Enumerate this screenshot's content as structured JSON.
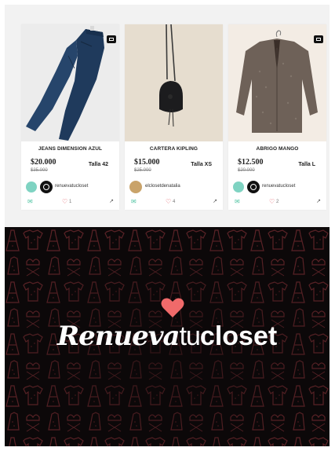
{
  "products": [
    {
      "title": "JEANS DIMENSION AZUL",
      "price": "$20.000",
      "old_price": "$35.000",
      "size": "Talla 42",
      "seller": "renuevatucloset",
      "likes": "1",
      "photo_icon": "jeans"
    },
    {
      "title": "CARTERA KIPLING",
      "price": "$15.000",
      "old_price": "$25.000",
      "size": "Talla XS",
      "seller": "elclosetdenatalia",
      "likes": "4",
      "photo_icon": "bag"
    },
    {
      "title": "ABRIGO MANGO",
      "price": "$12.500",
      "old_price": "$20.000",
      "size": "Talla L",
      "seller": "renuevatucloset",
      "likes": "2",
      "photo_icon": "jacket"
    }
  ],
  "banner": {
    "word1": "Renueva",
    "word2": "tu",
    "word3": "closet",
    "heart_icon": "heart-icon",
    "colors": {
      "background": "#0c0809",
      "pattern": "#4a1c1f",
      "heart": "#f06a6a"
    }
  },
  "icons": {
    "comment": "chat-bubble-icon",
    "like": "heart-icon",
    "share": "share-arrow-icon",
    "badge": "photo-badge-icon"
  }
}
